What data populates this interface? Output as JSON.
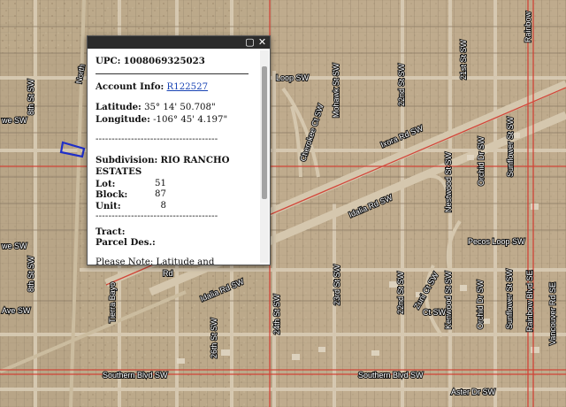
{
  "map": {
    "road_labels": [
      {
        "id": "loop-sw-top",
        "text": "Loop SW"
      },
      {
        "id": "22nd-st-sw",
        "text": "22nd St SW"
      },
      {
        "id": "mohawk-st-sw",
        "text": "Mohawk St SW"
      },
      {
        "id": "21st-st-sw",
        "text": "21st St SW"
      },
      {
        "id": "rainbow-top",
        "text": "Rainbow"
      },
      {
        "id": "8th-st-sw-top",
        "text": "8th St SW"
      },
      {
        "id": "we-sw-top",
        "text": "we SW"
      },
      {
        "id": "cherokee-ct-sw",
        "text": "Cherokee Ct SW"
      },
      {
        "id": "ixora-rd-sw",
        "text": "Ixora Rd SW"
      },
      {
        "id": "idalia-rd-sw-1",
        "text": "Idalia Rd SW"
      },
      {
        "id": "idalia-rd-sw-2",
        "text": "Idalia Rd SW"
      },
      {
        "id": "nestwood-st-sw",
        "text": "Nestwood St SW"
      },
      {
        "id": "orchid-dr-sw-top",
        "text": "Orchid Dr SW"
      },
      {
        "id": "sunflower-st-sw-top",
        "text": "Sunflower St SW"
      },
      {
        "id": "pecos-loop-sw",
        "text": "Pecos Loop SW"
      },
      {
        "id": "tierra-bayo",
        "text": "Tierra Bayo"
      },
      {
        "id": "8th-st-sw-bottom",
        "text": "8th St SW"
      },
      {
        "id": "ave-sw",
        "text": "Ave SW"
      },
      {
        "id": "we-sw-mid",
        "text": "we SW"
      },
      {
        "id": "26th-st-sw",
        "text": "26th St SW"
      },
      {
        "id": "24th-st-sw",
        "text": "24th St SW"
      },
      {
        "id": "23rd-st-sw",
        "text": "23rd St SW"
      },
      {
        "id": "22nd-st-sw-bottom",
        "text": "22nd St SW"
      },
      {
        "id": "zuni-ct-sw",
        "text": "Zuni Ct SW"
      },
      {
        "id": "kenwood-st-sw",
        "text": "Kenwood St SW"
      },
      {
        "id": "orchid-dr-sw-bottom",
        "text": "Orchid Dr SW"
      },
      {
        "id": "sunflower-st-sw-bottom",
        "text": "Sunflower St SW"
      },
      {
        "id": "rainbow-blvd-se",
        "text": "Rainbow Blvd SE"
      },
      {
        "id": "vancouver-rd-se",
        "text": "Vancouver Rd SE"
      },
      {
        "id": "southern-blvd-sw-1",
        "text": "Southern Blvd SW"
      },
      {
        "id": "southern-blvd-sw-2",
        "text": "Southern Blvd SW"
      },
      {
        "id": "aster-dr-sw",
        "text": "Aster Dr SW"
      },
      {
        "id": "ct-sw",
        "text": "Ct SW"
      },
      {
        "id": "north-fragment",
        "text": "North"
      },
      {
        "id": "rd-fragment",
        "text": "Rd"
      }
    ],
    "colors": {
      "aerial": "#b9a88c",
      "boundary": "#d23a2e",
      "highlight": "#1f2fc8"
    }
  },
  "popup": {
    "upc_label": "UPC:",
    "upc_value": "1008069325023",
    "account_label": "Account Info:",
    "account_value": "R122527",
    "latitude_label": "Latitude:",
    "latitude_value": "35° 14' 50.708\"",
    "longitude_label": "Longitude:",
    "longitude_value": "-106° 45' 4.197\"",
    "separator": "--------------------------------------",
    "subdivision_label": "Subdivision:",
    "subdivision_value": "RIO RANCHO ESTATES",
    "lot_label": "Lot:",
    "lot_value": "51",
    "block_label": "Block:",
    "block_value": "87",
    "unit_label": "Unit:",
    "unit_value": "8",
    "tract_label": "Tract:",
    "parcel_label": "Parcel Des.:",
    "note": "Please Note: Latitude and Longitude is the approximate center of the parcel shown.",
    "maximize_icon": "maximize-icon",
    "close_icon": "close-icon"
  }
}
